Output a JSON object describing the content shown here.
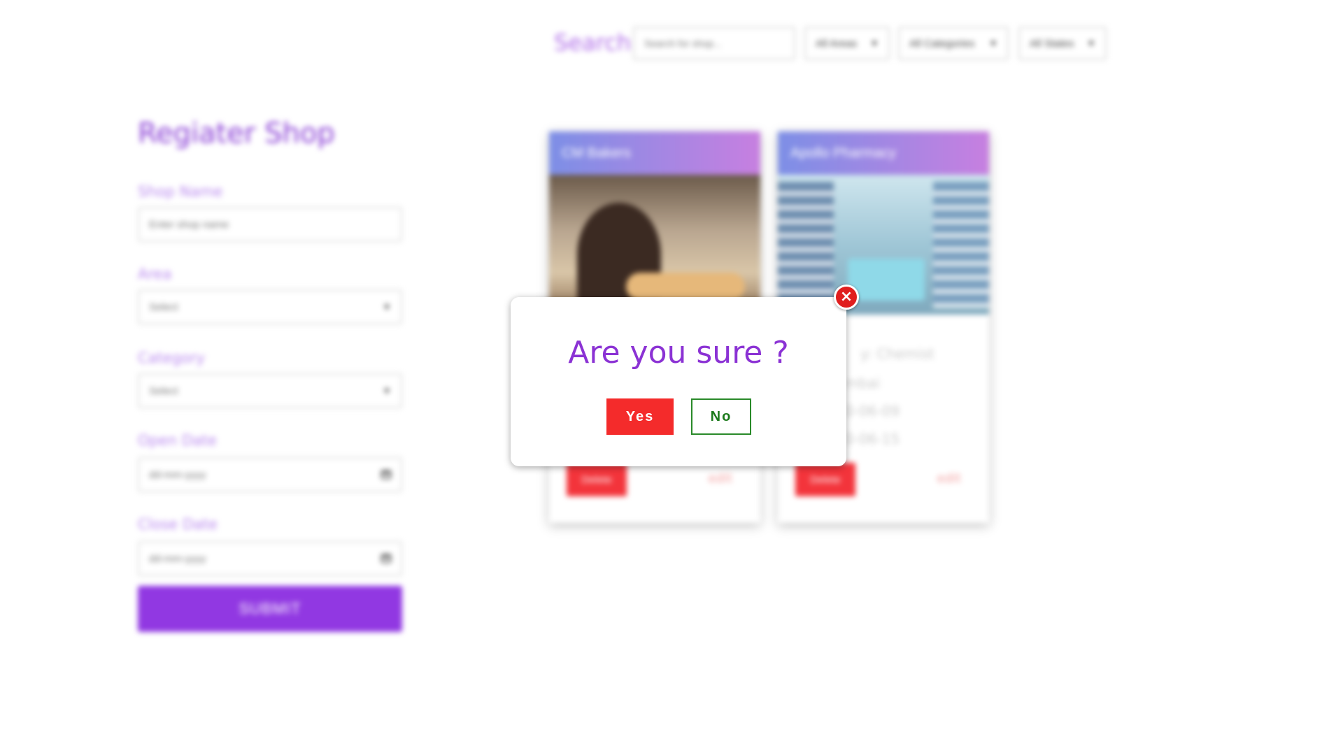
{
  "search": {
    "label": "Search",
    "placeholder": "Search for shop...",
    "area_filter": "All Areas",
    "category_filter": "All Categories",
    "state_filter": "All States"
  },
  "form": {
    "title": "Regiater Shop",
    "shop_name_label": "Shop Name",
    "shop_name_placeholder": "Enter shop name",
    "area_label": "Area",
    "area_value": "Select",
    "category_label": "Category",
    "category_value": "Select",
    "open_date_label": "Open Date",
    "open_date_placeholder": "dd-mm-yyyy",
    "close_date_label": "Close Date",
    "close_date_placeholder": "dd-mm-yyyy",
    "submit_label": "SUBMIT"
  },
  "cards": [
    {
      "name": "CM Bakers",
      "delete_label": "Delete",
      "edit_label": "edit"
    },
    {
      "name": "Apollo Pharmacy",
      "category_text": "y: Chemist",
      "area_text": "mbai",
      "open_text": "0-06-09",
      "close_text": "0-06-15",
      "delete_label": "Delete",
      "edit_label": "edit"
    }
  ],
  "modal": {
    "title": "Are you sure ?",
    "yes_label": "Yes",
    "no_label": "No",
    "close_icon": "×"
  },
  "colors": {
    "accent": "#9138e2",
    "danger": "#f42b2b",
    "success": "#2a8a2a"
  }
}
